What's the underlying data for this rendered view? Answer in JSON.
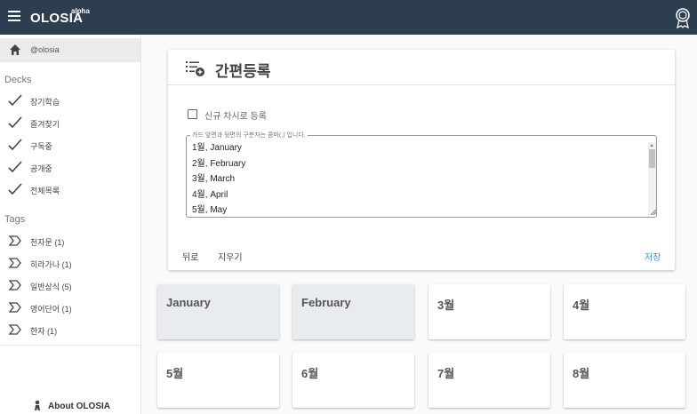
{
  "topbar": {
    "brand": "OLOSIA",
    "brand_sup": "alpha",
    "menu_icon": "hamburger-menu-icon",
    "badge_icon": "award-badge-icon"
  },
  "sidebar": {
    "user": "@olosia",
    "decks_heading": "Decks",
    "decks": [
      {
        "label": "장기학습",
        "icon": "checkmark-icon"
      },
      {
        "label": "즐겨찾기",
        "icon": "checkmark-icon"
      },
      {
        "label": "구독중",
        "icon": "checkmark-icon"
      },
      {
        "label": "공개중",
        "icon": "checkmark-icon"
      },
      {
        "label": "전체목록",
        "icon": "checkmark-icon"
      }
    ],
    "tags_heading": "Tags",
    "tags": [
      {
        "label": "천자문 (1)",
        "icon": "tag-icon"
      },
      {
        "label": "히라가나 (1)",
        "icon": "tag-icon"
      },
      {
        "label": "일반상식 (5)",
        "icon": "tag-icon"
      },
      {
        "label": "영어단어 (1)",
        "icon": "tag-icon"
      },
      {
        "label": "한자 (1)",
        "icon": "tag-icon"
      }
    ],
    "about": "About OLOSIA"
  },
  "panel": {
    "title": "간편등록",
    "checkbox_label": "신규 차시로 등록",
    "checkbox_checked": false,
    "textarea_legend": "카드 앞면과 뒷면의 구분자는 콤마(,) 입니다.",
    "textarea_lines": [
      "1월, January",
      "2월, February",
      "3월, March",
      "4월, April",
      "5월, May"
    ],
    "actions": {
      "back": "뒤로",
      "clear": "지우기",
      "save": "저장"
    }
  },
  "cards": [
    {
      "title": "January",
      "filled": true
    },
    {
      "title": "February",
      "filled": true
    },
    {
      "title": "3월",
      "filled": false
    },
    {
      "title": "4월",
      "filled": false
    },
    {
      "title": "5월",
      "filled": false
    },
    {
      "title": "6월",
      "filled": false
    },
    {
      "title": "7월",
      "filled": false
    },
    {
      "title": "8월",
      "filled": false
    }
  ],
  "colors": {
    "topbar": "#2c3e50",
    "accent": "#3b8fd9",
    "filled_card": "#e9ecef"
  }
}
